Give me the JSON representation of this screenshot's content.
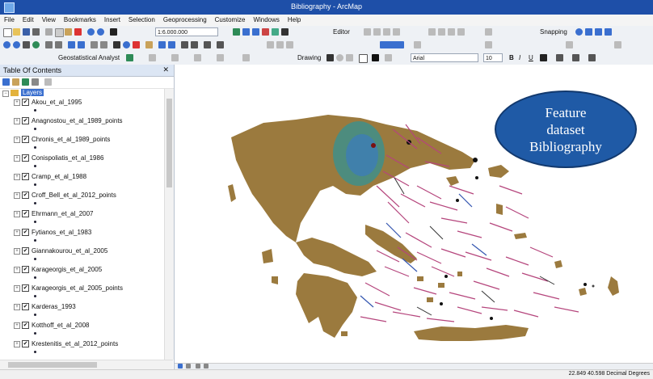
{
  "window": {
    "title": "Bibliography - ArcMap"
  },
  "menu": [
    "File",
    "Edit",
    "View",
    "Bookmarks",
    "Insert",
    "Selection",
    "Geoprocessing",
    "Customize",
    "Windows",
    "Help"
  ],
  "toolbar": {
    "scale_value": "1:6.000.000",
    "editor_label": "Editor",
    "snapping_label": "Snapping",
    "geostat_label": "Geostatistical Analyst",
    "drawing_label": "Drawing",
    "font_name": "Arial",
    "font_size": "10",
    "bold_label": "B",
    "italic_label": "I",
    "underline_label": "U"
  },
  "toc": {
    "title": "Table Of Contents",
    "pin_label": "✕",
    "root_group": "Layers",
    "layers": [
      "Akou_et_al_1995",
      "Anagnostou_et_al_1989_points",
      "Chronis_et_al_1989_points",
      "Conispoliatis_et_al_1986",
      "Cramp_et_al_1988",
      "Croff_Bell_et_al_2012_points",
      "Ehrmann_et_al_2007",
      "Fytianos_et_al_1983",
      "Giannakourou_et_al_2005",
      "Karageorgis_et_al_2005",
      "Karageorgis_et_al_2005_points",
      "Karderas_1993",
      "Kotthoff_et_al_2008",
      "Krestenitis_et_al_2012_points"
    ]
  },
  "callout": {
    "lines": [
      "Feature",
      "dataset",
      "Bibliography"
    ]
  },
  "status": {
    "coordinates": "22.849  40.598 Decimal Degrees"
  },
  "colors": {
    "land": "#9b7a3e",
    "lines": "#b5457c",
    "titlebar": "#1e4fa8",
    "callout": "#1f5aa6"
  }
}
